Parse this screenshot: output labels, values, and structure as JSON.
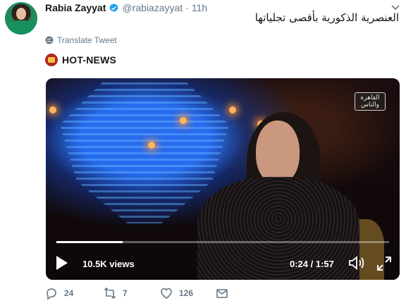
{
  "tweet": {
    "author_name": "Rabia Zayyat",
    "handle": "@rabiazayyat",
    "separator": "·",
    "time": "11h",
    "text": "العنصرية الذكورية بأقصى تجلياتها",
    "translate_label": "Translate Tweet"
  },
  "source": {
    "name": "HOT-NEWS"
  },
  "video": {
    "channel_logo_line1": "القاهرة",
    "channel_logo_line2": "والناس",
    "views": "10.5K views",
    "time": "0:24 / 1:57",
    "progress": 0.2
  },
  "actions": {
    "replies": "24",
    "retweets": "7",
    "likes": "126"
  },
  "colors": {
    "verified": "#1da1f2",
    "secondary_text": "#657786",
    "source_logo": "#b3261e"
  },
  "icons": {
    "verified": "verified-badge-icon",
    "globe": "globe-icon",
    "play": "play-icon",
    "volume": "volume-icon",
    "fullscreen": "fullscreen-icon",
    "reply": "reply-icon",
    "retweet": "retweet-icon",
    "like": "heart-icon",
    "dm": "envelope-icon",
    "menu": "chevron-down-icon"
  }
}
